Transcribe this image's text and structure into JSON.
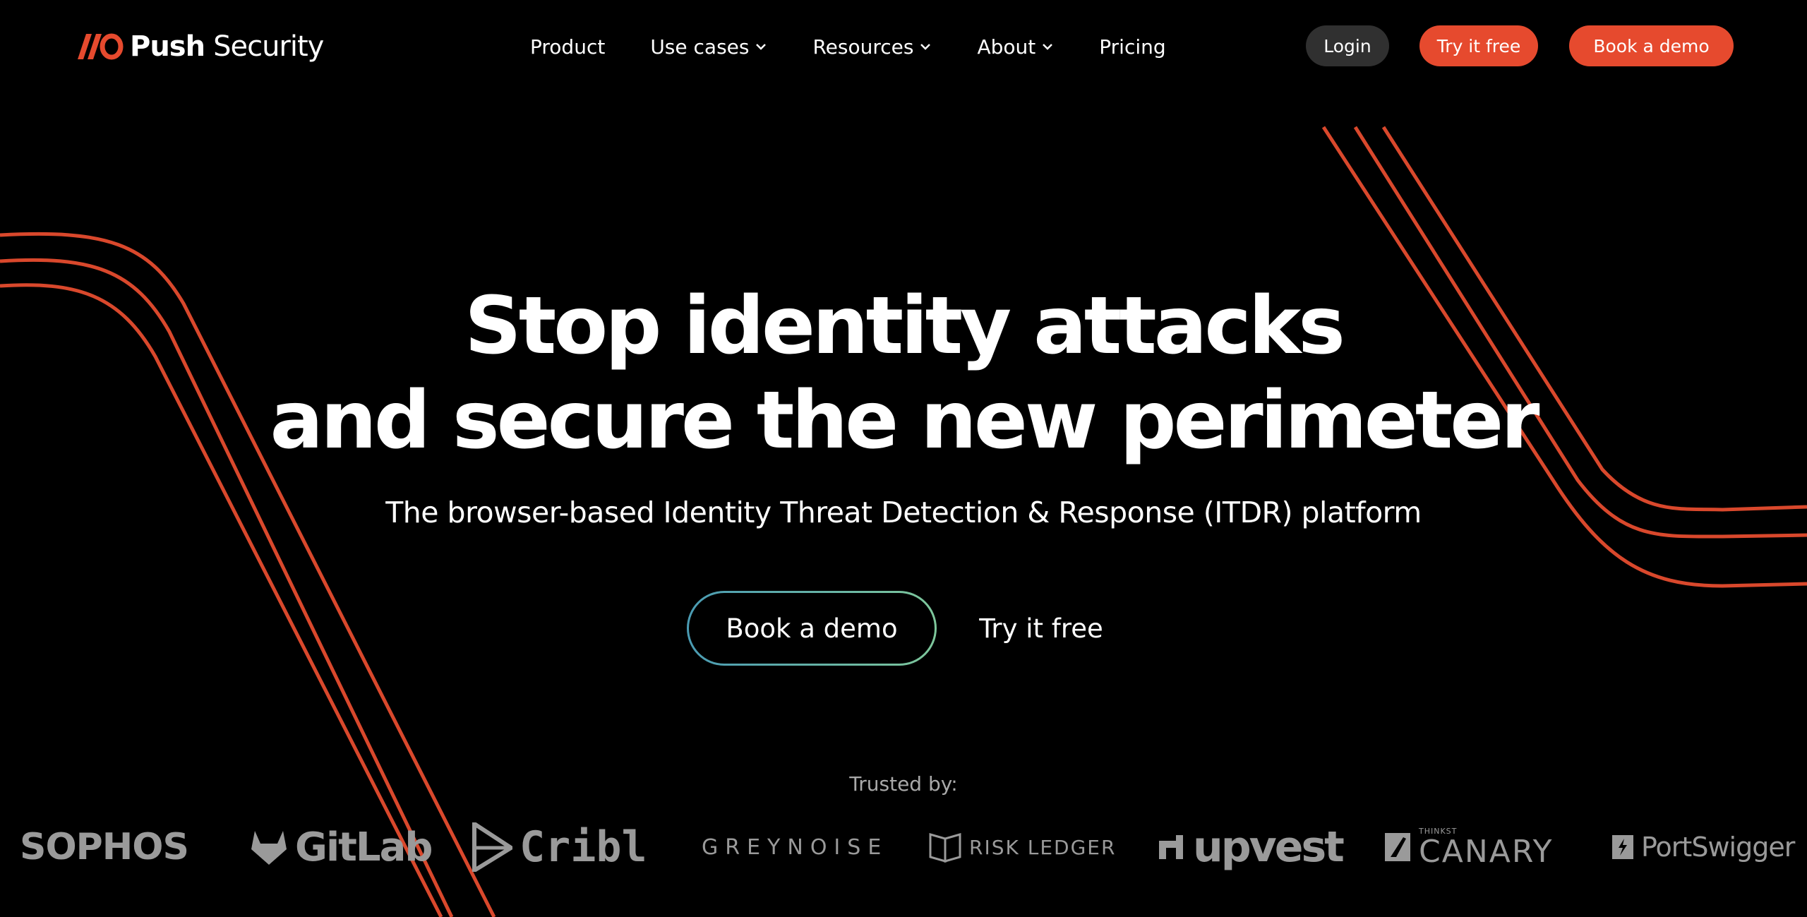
{
  "brand": {
    "name_bold": "Push",
    "name_light": "Security",
    "accent_color": "#e64a2e",
    "logo_icon": "push-slash-o-logo"
  },
  "nav": {
    "items": [
      {
        "label": "Product",
        "has_dropdown": false
      },
      {
        "label": "Use cases",
        "has_dropdown": true
      },
      {
        "label": "Resources",
        "has_dropdown": true
      },
      {
        "label": "About",
        "has_dropdown": true
      },
      {
        "label": "Pricing",
        "has_dropdown": false
      }
    ],
    "login_label": "Login",
    "try_label": "Try it free",
    "demo_label": "Book a demo"
  },
  "hero": {
    "title_line1": "Stop identity attacks",
    "title_line2": "and secure the new perimeter",
    "subtitle": "The browser-based Identity Threat Detection & Response (ITDR) platform",
    "cta_primary": "Book a demo",
    "cta_secondary": "Try it free"
  },
  "trusted": {
    "label": "Trusted by:",
    "logos": [
      {
        "name": "SOPHOS",
        "icon": "sophos-logo"
      },
      {
        "name": "GitLab",
        "icon": "gitlab-fox-icon"
      },
      {
        "name": "Cribl",
        "icon": "cribl-logo"
      },
      {
        "name": "GREYNOISE",
        "icon": "greynoise-logo"
      },
      {
        "name": "RISK LEDGER",
        "icon": "risk-ledger-book-icon"
      },
      {
        "name": "upvest",
        "icon": "upvest-logo"
      },
      {
        "name": "CANARY",
        "small": "THINKST",
        "icon": "canary-bird-icon"
      },
      {
        "name": "PortSwigger",
        "icon": "portswigger-logo"
      }
    ]
  },
  "colors": {
    "background": "#000000",
    "line_accent": "#d9482c",
    "cta_gradient_start": "#4a9bb3",
    "cta_gradient_end": "#7ec79b",
    "login_bg": "#303030",
    "logo_gray": "#9a9a9a"
  }
}
